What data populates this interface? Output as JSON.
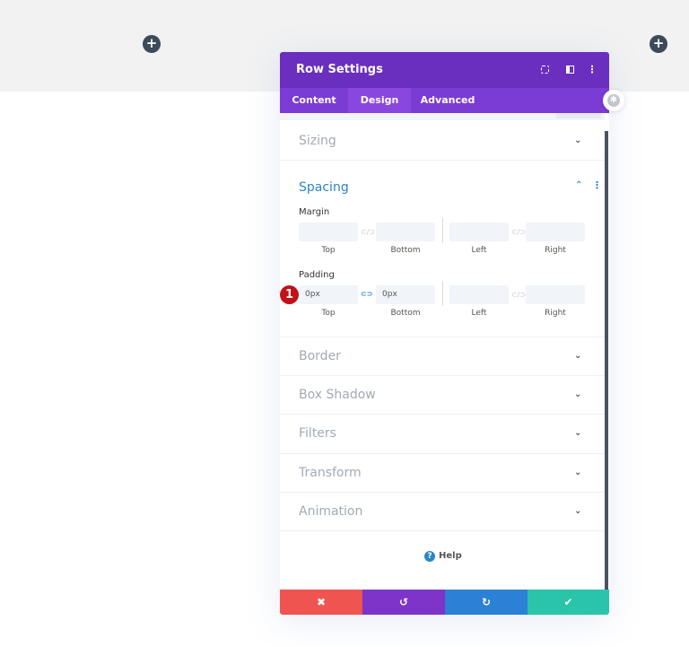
{
  "canvas": {
    "add_icon": "plus-icon"
  },
  "panel": {
    "title": "Row Settings",
    "header_icons": [
      "expand-icon",
      "split-view-icon",
      "more-options-icon"
    ],
    "tabs": [
      {
        "label": "Content",
        "active": false
      },
      {
        "label": "Design",
        "active": true
      },
      {
        "label": "Advanced",
        "active": false
      }
    ],
    "sections": {
      "sizing": "Sizing",
      "spacing": "Spacing",
      "border": "Border",
      "box_shadow": "Box Shadow",
      "filters": "Filters",
      "transform": "Transform",
      "animation": "Animation"
    },
    "spacing": {
      "margin": {
        "label": "Margin",
        "top": {
          "label": "Top",
          "value": ""
        },
        "bottom": {
          "label": "Bottom",
          "value": ""
        },
        "left": {
          "label": "Left",
          "value": ""
        },
        "right": {
          "label": "Right",
          "value": ""
        }
      },
      "padding": {
        "label": "Padding",
        "top": {
          "label": "Top",
          "value": "0px"
        },
        "bottom": {
          "label": "Bottom",
          "value": "0px"
        },
        "left": {
          "label": "Left",
          "value": ""
        },
        "right": {
          "label": "Right",
          "value": ""
        }
      }
    },
    "step_marker": "1",
    "help_label": "Help",
    "footer": {
      "cancel": "✖",
      "undo": "↺",
      "redo": "↻",
      "save": "✔"
    },
    "colors": {
      "header": "#6a2fbf",
      "tabs": "#7b3bd5",
      "active_accent": "#2b87c5",
      "cancel": "#ef5451",
      "undo": "#7e33c9",
      "redo": "#2b81d6",
      "save": "#29c4a9"
    }
  }
}
